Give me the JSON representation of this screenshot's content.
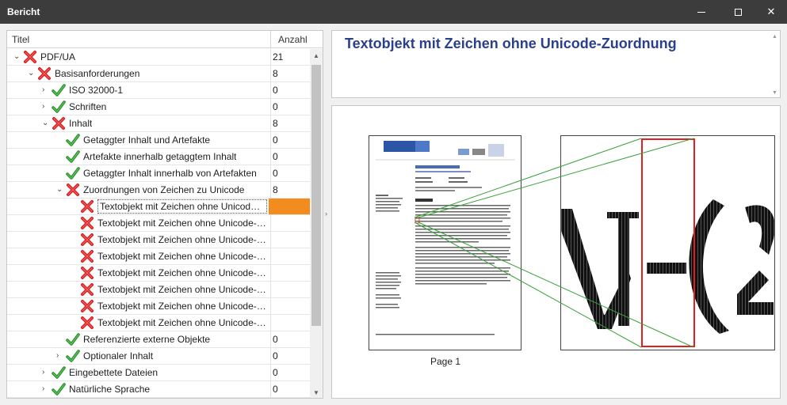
{
  "window": {
    "title": "Bericht"
  },
  "tree": {
    "col_title": "Titel",
    "col_count": "Anzahl",
    "rows": [
      {
        "label": "PDF/UA",
        "count": "21",
        "status": "fail",
        "level": 0,
        "expander": "expanded"
      },
      {
        "label": "Basisanforderungen",
        "count": "8",
        "status": "fail",
        "level": 1,
        "expander": "expanded"
      },
      {
        "label": "ISO 32000-1",
        "count": "0",
        "status": "pass",
        "level": 2,
        "expander": "collapsed"
      },
      {
        "label": "Schriften",
        "count": "0",
        "status": "pass",
        "level": 2,
        "expander": "collapsed"
      },
      {
        "label": "Inhalt",
        "count": "8",
        "status": "fail",
        "level": 2,
        "expander": "expanded"
      },
      {
        "label": "Getaggter Inhalt und Artefakte",
        "count": "0",
        "status": "pass",
        "level": 3,
        "expander": "none"
      },
      {
        "label": "Artefakte innerhalb getaggtem Inhalt",
        "count": "0",
        "status": "pass",
        "level": 3,
        "expander": "none"
      },
      {
        "label": "Getaggter Inhalt innerhalb von Artefakten",
        "count": "0",
        "status": "pass",
        "level": 3,
        "expander": "none"
      },
      {
        "label": "Zuordnungen von Zeichen zu Unicode",
        "count": "8",
        "status": "fail",
        "level": 3,
        "expander": "expanded"
      },
      {
        "label": "Textobjekt mit Zeichen ohne Unicode-Zuo...",
        "count": "",
        "status": "fail",
        "level": 4,
        "expander": "none",
        "selected": true
      },
      {
        "label": "Textobjekt mit Zeichen ohne Unicode-Zuo...",
        "count": "",
        "status": "fail",
        "level": 4,
        "expander": "none"
      },
      {
        "label": "Textobjekt mit Zeichen ohne Unicode-Zuo...",
        "count": "",
        "status": "fail",
        "level": 4,
        "expander": "none"
      },
      {
        "label": "Textobjekt mit Zeichen ohne Unicode-Zuo...",
        "count": "",
        "status": "fail",
        "level": 4,
        "expander": "none"
      },
      {
        "label": "Textobjekt mit Zeichen ohne Unicode-Zuo...",
        "count": "",
        "status": "fail",
        "level": 4,
        "expander": "none"
      },
      {
        "label": "Textobjekt mit Zeichen ohne Unicode-Zuo...",
        "count": "",
        "status": "fail",
        "level": 4,
        "expander": "none"
      },
      {
        "label": "Textobjekt mit Zeichen ohne Unicode-Zuo...",
        "count": "",
        "status": "fail",
        "level": 4,
        "expander": "none"
      },
      {
        "label": "Textobjekt mit Zeichen ohne Unicode-Zuo...",
        "count": "",
        "status": "fail",
        "level": 4,
        "expander": "none"
      },
      {
        "label": "Referenzierte externe Objekte",
        "count": "0",
        "status": "pass",
        "level": 3,
        "expander": "none"
      },
      {
        "label": "Optionaler Inhalt",
        "count": "0",
        "status": "pass",
        "level": 3,
        "expander": "collapsed"
      },
      {
        "label": "Eingebettete Dateien",
        "count": "0",
        "status": "pass",
        "level": 2,
        "expander": "collapsed"
      },
      {
        "label": "Natürliche Sprache",
        "count": "0",
        "status": "pass",
        "level": 2,
        "expander": "collapsed"
      }
    ]
  },
  "detail": {
    "heading": "Textobjekt mit Zeichen ohne Unicode-Zuordnung",
    "page_label": "Page 1"
  },
  "colors": {
    "heading": "#2b3f8f",
    "fail": "#d32020",
    "pass": "#3aa33a",
    "selection_count_bg": "#f28c1e",
    "highlight_box": "#e02020",
    "connector": "#3aa33a"
  }
}
